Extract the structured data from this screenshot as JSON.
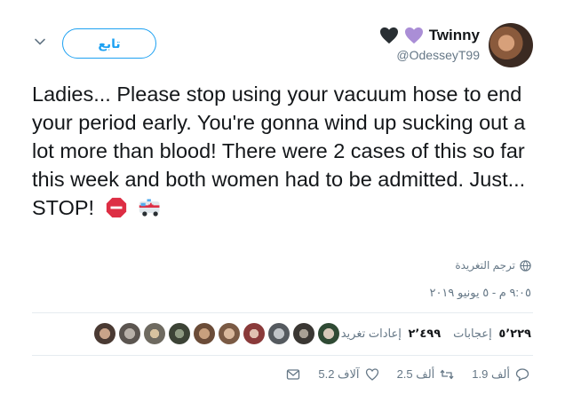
{
  "author": {
    "name": "Twinny",
    "handle": "@OdesseyT99",
    "hearts": [
      "black-heart",
      "purple-heart"
    ]
  },
  "follow_label": "تابع",
  "tweet": {
    "text": "Ladies... Please stop using your vacuum hose to end your period early. You're gonna wind up sucking out a lot more than blood! There were 2 cases of this so far this week and both women had to be admitted. Just... STOP!",
    "emojis": [
      "stop-sign",
      "ambulance"
    ]
  },
  "translate_label": "ترجم التغريدة",
  "timestamp": "٩:٠٥ م - ٥ يونيو ٢٠١٩",
  "stats": {
    "retweets_count": "٢٬٤٩٩",
    "retweets_label": "إعادات تغريد",
    "likes_count": "٥٬٢٢٩",
    "likes_label": "إعجابات"
  },
  "actions": {
    "replies": "1.9 ألف",
    "retweets": "2.5 ألف",
    "likes": "5.2 آلاف"
  },
  "colors": {
    "accent": "#1da1f2",
    "muted": "#657786",
    "text": "#14171a"
  }
}
